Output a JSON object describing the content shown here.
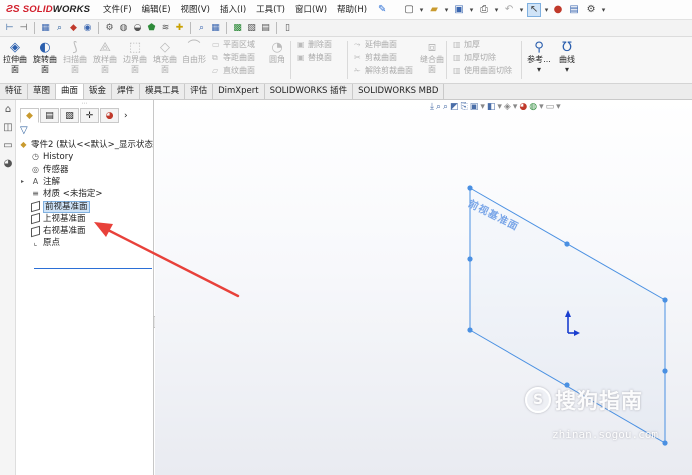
{
  "app": {
    "logo_ds": "ƧS",
    "logo_solid": "SOLID",
    "logo_works": "WORKS"
  },
  "menu": [
    "文件(F)",
    "编辑(E)",
    "视图(V)",
    "插入(I)",
    "工具(T)",
    "窗口(W)",
    "帮助(H)"
  ],
  "ribbon": {
    "extrude_label": "拉伸曲面",
    "revolve_label": "旋转曲面",
    "sweep_label": "扫描曲面",
    "loft_label": "放样曲面",
    "boundary_label": "边界曲面",
    "fill_label": "填充曲面",
    "freeform_label": "自由形",
    "planar_label": "平面区域",
    "offset_label": "等距曲面",
    "ruled_label": "直纹曲面",
    "fillet_label": "圆角",
    "delete_face_label": "删除面",
    "replace_face_label": "替换面",
    "extend_label": "延伸曲面",
    "trim_label": "剪裁曲面",
    "untrim_label": "解除剪裁曲面",
    "knit_label": "缝合曲面",
    "thicken_label": "加厚",
    "thicken_cut_label": "加厚切除",
    "surface_cut_label": "使用曲面切除",
    "reference_label": "参考...",
    "curves_label": "曲线"
  },
  "tabs": [
    "特征",
    "草图",
    "曲面",
    "钣金",
    "焊件",
    "模具工具",
    "评估",
    "DimXpert",
    "SOLIDWORKS 插件",
    "SOLIDWORKS MBD"
  ],
  "active_tab": "曲面",
  "tree": {
    "root": "零件2 (默认<<默认>_显示状态",
    "history": "History",
    "sensors": "传感器",
    "annotations": "注解",
    "material": "材质 <未指定>",
    "front_plane": "前视基准面",
    "top_plane": "上视基准面",
    "right_plane": "右视基准面",
    "origin": "原点"
  },
  "viewport": {
    "plane_label": "前视基准面"
  },
  "watermark": {
    "symbol": "S",
    "text": "搜狗指南",
    "url": "zhinan.sogou.com"
  },
  "colors": {
    "accent": "#2b6fd6",
    "plane": "#4a90e2",
    "arrow": "#e8413a",
    "logo_red": "#d21e2b"
  },
  "icons": [
    "new-icon",
    "open-icon",
    "save-icon",
    "print-icon",
    "undo-icon",
    "select-icon",
    "rebuild-icon",
    "options-icon"
  ]
}
